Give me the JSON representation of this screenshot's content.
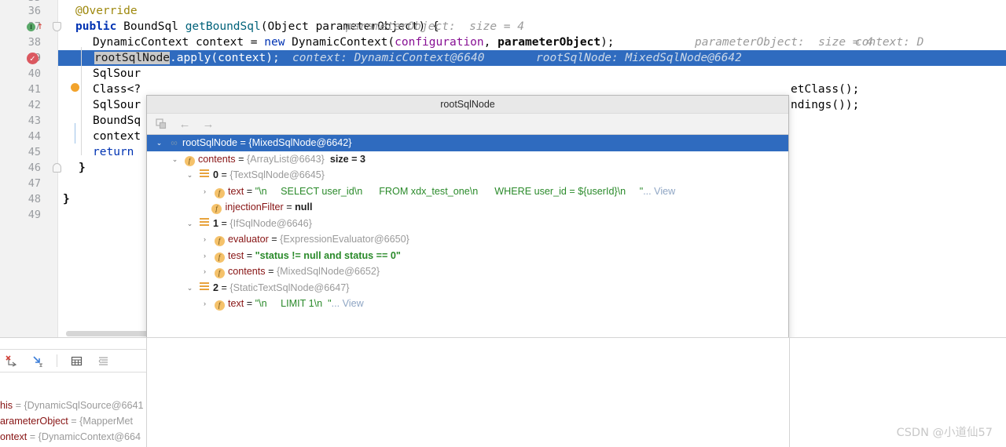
{
  "editor": {
    "lines": [
      {
        "num": "35",
        "tokens": []
      },
      {
        "num": "36",
        "indent": 4,
        "text_annotation": "@Override"
      },
      {
        "num": "37",
        "text_annotation": "public BoundSql getBoundSql(Object parameterObject) {",
        "hint": "parameterObject:  size = 4"
      },
      {
        "num": "38",
        "text_annotation": "DynamicContext context = new DynamicContext(configuration, parameterObject);",
        "hint": "parameterObject:  size = 4    context: D"
      },
      {
        "num": "39",
        "text_annotation": "rootSqlNode.apply(context);",
        "hint": "context: DynamicContext@6640     rootSqlNode: MixedSqlNode@6642"
      },
      {
        "num": "40",
        "text_annotation": "SqlSour"
      },
      {
        "num": "41",
        "text_annotation": "Class<?",
        "tail": "etClass();"
      },
      {
        "num": "42",
        "text_annotation": "SqlSour",
        "tail": "ndings());"
      },
      {
        "num": "43",
        "text_annotation": "BoundSq"
      },
      {
        "num": "44",
        "text_annotation": "context"
      },
      {
        "num": "45",
        "text_annotation": "return"
      },
      {
        "num": "46",
        "text_annotation": "}"
      },
      {
        "num": "47",
        "text_annotation": ""
      },
      {
        "num": "48",
        "text_annotation": "}"
      },
      {
        "num": "49",
        "text_annotation": ""
      }
    ],
    "line36": {
      "annotation": "@Override"
    },
    "line37": {
      "kw_public": "public",
      "type_boundsql": "BoundSql",
      "method": "getBoundSql",
      "paren_open": "(",
      "type_object": "Object",
      "param": "parameterObject",
      "paren_close": ") {",
      "hint": "parameterObject:  size = 4"
    },
    "line38": {
      "type1": "DynamicContext",
      "var1": "context",
      "eq": " = ",
      "kw_new": "new",
      "type2": "DynamicContext",
      "paren": "(",
      "field": "configuration",
      "comma": ", ",
      "param": "parameterObject",
      "close": ");",
      "hint1": "parameterObject:  size = 4",
      "hint2": "context: D"
    },
    "line39": {
      "selected_token": "rootSqlNode",
      "rest": ".apply(context);",
      "hint1": "context: DynamicContext@6640",
      "hint2": "rootSqlNode: MixedSqlNode@6642"
    },
    "line40": "SqlSour",
    "line41": "Class<?",
    "line41_tail": "etClass();",
    "line42": "SqlSour",
    "line42_tail": "ndings());",
    "line43": "BoundSq",
    "line44": "context",
    "line45": "return",
    "line46": "}",
    "line48": "}",
    "gutter_icons": {
      "line37_override": "override-method-icon",
      "line37_arrow": "implementing-arrow-icon",
      "line39_breakpoint": "breakpoint-verified-icon",
      "line46_fold": "fold-collapse-icon"
    },
    "breakpoint_pin": "execution-pointer-pin"
  },
  "popup": {
    "title": "rootSqlNode",
    "toolbar": {
      "copy_label": "copy-value-icon",
      "back_label": "←",
      "forward_label": "→"
    },
    "tree": [
      {
        "indent": 0,
        "arrow": "⌄",
        "icon": "chain-icon",
        "selected": true,
        "name": "rootSqlNode",
        "eq": " = ",
        "value": "{MixedSqlNode@6642}"
      },
      {
        "indent": 1,
        "arrow": "⌄",
        "icon": "field-icon",
        "selected": false,
        "name": "contents",
        "eq": " = ",
        "value": "{ArrayList@6643}",
        "extra": "size = 3"
      },
      {
        "indent": 2,
        "arrow": "⌄",
        "icon": "list-icon",
        "selected": false,
        "name": "0",
        "eq": " = ",
        "value": "{TextSqlNode@6645}"
      },
      {
        "indent": 3,
        "arrow": "›",
        "icon": "field-icon",
        "selected": false,
        "name": "text",
        "eq": " = ",
        "string_parts": [
          "\"\\n",
          "SELECT user_id\\n",
          "FROM xdx_test_one\\n",
          "WHERE user_id = ${userId}\\n",
          "\""
        ],
        "view": "... View"
      },
      {
        "indent": 3,
        "arrow": "",
        "icon": "field-icon",
        "selected": false,
        "name": "injectionFilter",
        "eq": " = ",
        "nullval": "null"
      },
      {
        "indent": 2,
        "arrow": "⌄",
        "icon": "list-icon",
        "selected": false,
        "name": "1",
        "eq": " = ",
        "value": "{IfSqlNode@6646}"
      },
      {
        "indent": 3,
        "arrow": "›",
        "icon": "field-icon",
        "selected": false,
        "name": "evaluator",
        "eq": " = ",
        "value": "{ExpressionEvaluator@6650}"
      },
      {
        "indent": 3,
        "arrow": "›",
        "icon": "field-icon",
        "selected": false,
        "name": "test",
        "eq": " = ",
        "str": "\"status != null and status == 0\""
      },
      {
        "indent": 3,
        "arrow": "›",
        "icon": "field-icon",
        "selected": false,
        "name": "contents",
        "eq": " = ",
        "value": "{MixedSqlNode@6652}"
      },
      {
        "indent": 2,
        "arrow": "⌄",
        "icon": "list-icon",
        "selected": false,
        "name": "2",
        "eq": " = ",
        "value": "{StaticTextSqlNode@6647}"
      },
      {
        "indent": 3,
        "arrow": "›",
        "icon": "field-icon",
        "selected": false,
        "name": "text",
        "eq": " = ",
        "string_parts2": [
          "\"\\n",
          "LIMIT 1\\n",
          "\""
        ],
        "view": "... View"
      }
    ]
  },
  "debug": {
    "toolbar_icons": [
      "add-to-watches-icon",
      "jump-to-source-icon",
      "view-as-table-icon",
      "collapse-all-icon"
    ],
    "variables": [
      {
        "name": "his",
        "value": " = {DynamicSqlSource@6641"
      },
      {
        "name": "arameterObject",
        "value": " = {MapperMet"
      },
      {
        "name": "ontext",
        "value": " = {DynamicContext@664"
      }
    ]
  },
  "watermark": "CSDN @小道仙57",
  "colors": {
    "selection_blue": "#2f6bbf",
    "gutter_bg": "#f2f2f2",
    "keyword": "#0033b3",
    "field": "#871094",
    "method": "#00627a",
    "string_green": "#2a8a2a",
    "tree_name_red": "#871313"
  }
}
